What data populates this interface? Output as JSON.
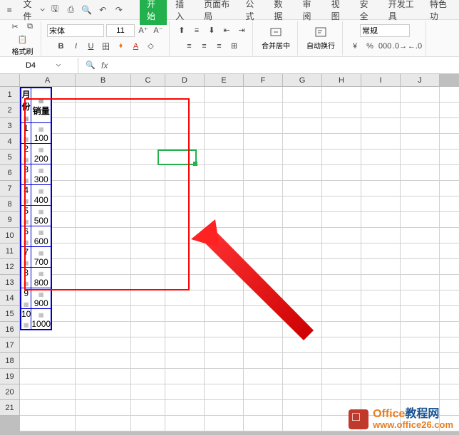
{
  "menubar": {
    "file_label": "文件"
  },
  "tabs": [
    "开始",
    "插入",
    "页面布局",
    "公式",
    "数据",
    "审阅",
    "视图",
    "安全",
    "开发工具",
    "特色功"
  ],
  "active_tab_index": 0,
  "ribbon": {
    "format_brush": "格式刷",
    "font_name": "宋体",
    "font_size": "11",
    "merge_center": "合并居中",
    "auto_wrap": "自动换行",
    "number_format": "常规"
  },
  "formula_bar": {
    "cell_ref": "D4",
    "fx": "fx",
    "formula": ""
  },
  "columns": [
    "A",
    "B",
    "C",
    "D",
    "E",
    "F",
    "G",
    "H",
    "I",
    "J"
  ],
  "rows": [
    "1",
    "2",
    "3",
    "4",
    "5",
    "6",
    "7",
    "8",
    "9",
    "10",
    "11",
    "12",
    "13",
    "14",
    "15",
    "16",
    "17",
    "18",
    "19",
    "20",
    "21"
  ],
  "chart_data": {
    "type": "table",
    "headers": [
      "月份",
      "销量"
    ],
    "rows": [
      {
        "month": "1",
        "sales": "100"
      },
      {
        "month": "2",
        "sales": "200"
      },
      {
        "month": "3",
        "sales": "300"
      },
      {
        "month": "4",
        "sales": "400"
      },
      {
        "month": "5",
        "sales": "500"
      },
      {
        "month": "6",
        "sales": "600"
      },
      {
        "month": "7",
        "sales": "700"
      },
      {
        "month": "8",
        "sales": "800"
      },
      {
        "month": "9",
        "sales": "900"
      },
      {
        "month": "10",
        "sales": "1000"
      }
    ]
  },
  "watermark": {
    "brand1": "Office",
    "brand2": "教程网",
    "url": "www.office26.com"
  }
}
